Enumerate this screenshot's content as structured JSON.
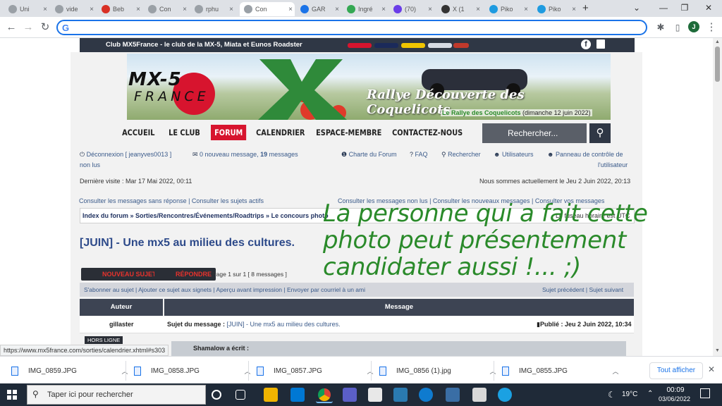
{
  "browser": {
    "tabs": [
      {
        "label": "Uni"
      },
      {
        "label": "vide"
      },
      {
        "label": "Beb"
      },
      {
        "label": "Con"
      },
      {
        "label": "rphu"
      },
      {
        "label": "Con"
      },
      {
        "label": "GAR"
      },
      {
        "label": "Ingré"
      },
      {
        "label": "(70)"
      },
      {
        "label": "X (1"
      },
      {
        "label": "Piko"
      },
      {
        "label": "Piko"
      }
    ],
    "active_tab_index": 5,
    "new_tab_symbol": "+",
    "close_symbol": "×",
    "address": "",
    "profile_initial": "J",
    "status_url": "https://www.mx5france.com/sorties/calendrier.xhtml#s303"
  },
  "site": {
    "topbar_title": "Club MX5France - le club de la MX-5, Miata et Eunos Roadster",
    "logo_text_top": "MX-5",
    "logo_text_bottom": "FRANCE",
    "logo_x": "X",
    "banner_title": "Rallye Découverte des Coquelicots",
    "banner_subtitle_name": "Le Rallye des Coquelicots",
    "banner_subtitle_date": " (dimanche 12 juin 2022)",
    "nav": [
      {
        "label": "ACCUEIL"
      },
      {
        "label": "LE CLUB"
      },
      {
        "label": "FORUM"
      },
      {
        "label": "CALENDRIER"
      },
      {
        "label": "ESPACE-MEMBRE"
      },
      {
        "label": "CONTACTEZ-NOUS"
      }
    ],
    "search_placeholder": "Rechercher..."
  },
  "forum": {
    "logout_label": "Déconnexion [ jeanyves0013 ]",
    "messages_prefix": "0 nouveau message, ",
    "messages_count": "19",
    "messages_suffix": " messages",
    "non_lus": "non lus",
    "charte": "Charte du Forum",
    "faq": "FAQ",
    "recherche": "Rechercher",
    "utilisateurs": "Utilisateurs",
    "panneau_line1": "Panneau de contrôle de",
    "panneau_line2": "l'utilisateur",
    "last_visit": "Dernière visite : Mar 17 Mai 2022, 00:11",
    "now": "Nous sommes actuellement le Jeu 2 Juin 2022, 20:13",
    "links_left": "Consulter les messages sans réponse | Consulter les sujets actifs",
    "links_right": "Consulter les messages non lus | Consulter les nouveaux messages | Consulter vos messages",
    "breadcrumb": "Index du forum » Sorties/Rencontres/Événements/Roadtrips » Le concours photo",
    "timezone": "Le fuseau horaire est UTC",
    "topic_title": "[JUIN] - Une mx5 au milieu des cultures.",
    "btn_new": "NOUVEAU SUJET",
    "btn_reply": "RÉPONDRE",
    "pager": "Page 1 sur 1   [ 8 messages ]",
    "actions_left": "S'abonner au sujet | Ajouter ce sujet aux signets | Aperçu avant impression | Envoyer par courriel à un ami",
    "actions_right": "Sujet précédent | Sujet suivant",
    "col_author": "Auteur",
    "col_message": "Message",
    "author": "gillaster",
    "subject_label": "Sujet du message : ",
    "subject_value": "[JUIN] - Une mx5 au milieu des cultures.",
    "published": "Publié : Jeu 2 Juin 2022, 10:34",
    "offline_badge": "HORS LIGNE",
    "quote_label": "Shamalow a écrit :"
  },
  "overlay_text": {
    "line1": "La personne qui a fait cette",
    "line2": "photo peut présentement",
    "line3": "candidater aussi !...   ;)"
  },
  "downloads": {
    "items": [
      {
        "name": "IMG_0859.JPG"
      },
      {
        "name": "IMG_0858.JPG"
      },
      {
        "name": "IMG_0857.JPG"
      },
      {
        "name": "IMG_0856 (1).jpg"
      },
      {
        "name": "IMG_0855.JPG"
      }
    ],
    "show_all": "Tout afficher"
  },
  "taskbar": {
    "search_placeholder": "Taper ici pour rechercher",
    "temperature": "19°C",
    "time": "00:09",
    "date": "03/06/2022"
  }
}
